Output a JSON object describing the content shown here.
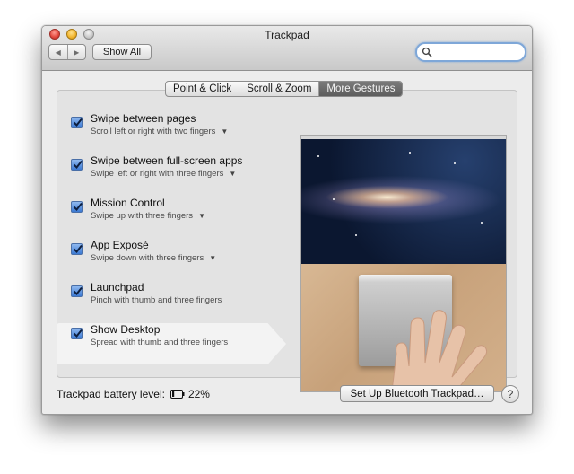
{
  "window": {
    "title": "Trackpad"
  },
  "toolbar": {
    "back_icon": "back-arrow-icon",
    "forward_icon": "forward-arrow-icon",
    "show_all_label": "Show All",
    "search": {
      "value": "",
      "placeholder": ""
    }
  },
  "tabs": [
    {
      "label": "Point & Click",
      "selected": false
    },
    {
      "label": "Scroll & Zoom",
      "selected": false
    },
    {
      "label": "More Gestures",
      "selected": true
    }
  ],
  "gestures": [
    {
      "title": "Swipe between pages",
      "subtitle": "Scroll left or right with two fingers",
      "checked": true,
      "has_dropdown": true
    },
    {
      "title": "Swipe between full-screen apps",
      "subtitle": "Swipe left or right with three fingers",
      "checked": true,
      "has_dropdown": true
    },
    {
      "title": "Mission Control",
      "subtitle": "Swipe up with three fingers",
      "checked": true,
      "has_dropdown": true
    },
    {
      "title": "App Exposé",
      "subtitle": "Swipe down with three fingers",
      "checked": true,
      "has_dropdown": true
    },
    {
      "title": "Launchpad",
      "subtitle": "Pinch with thumb and three fingers",
      "checked": true,
      "has_dropdown": false
    },
    {
      "title": "Show Desktop",
      "subtitle": "Spread with thumb and three fingers",
      "checked": true,
      "has_dropdown": false,
      "selected": true
    }
  ],
  "footer": {
    "battery_label": "Trackpad battery level:",
    "battery_percent": "22%",
    "battery_level": 0.22,
    "bluetooth_button": "Set Up Bluetooth Trackpad…",
    "help_label": "?"
  },
  "colors": {
    "checkbox_accent": "#3b79d3",
    "search_focus_ring": "#7ea7d8",
    "active_tab": "#5d5d5d"
  }
}
